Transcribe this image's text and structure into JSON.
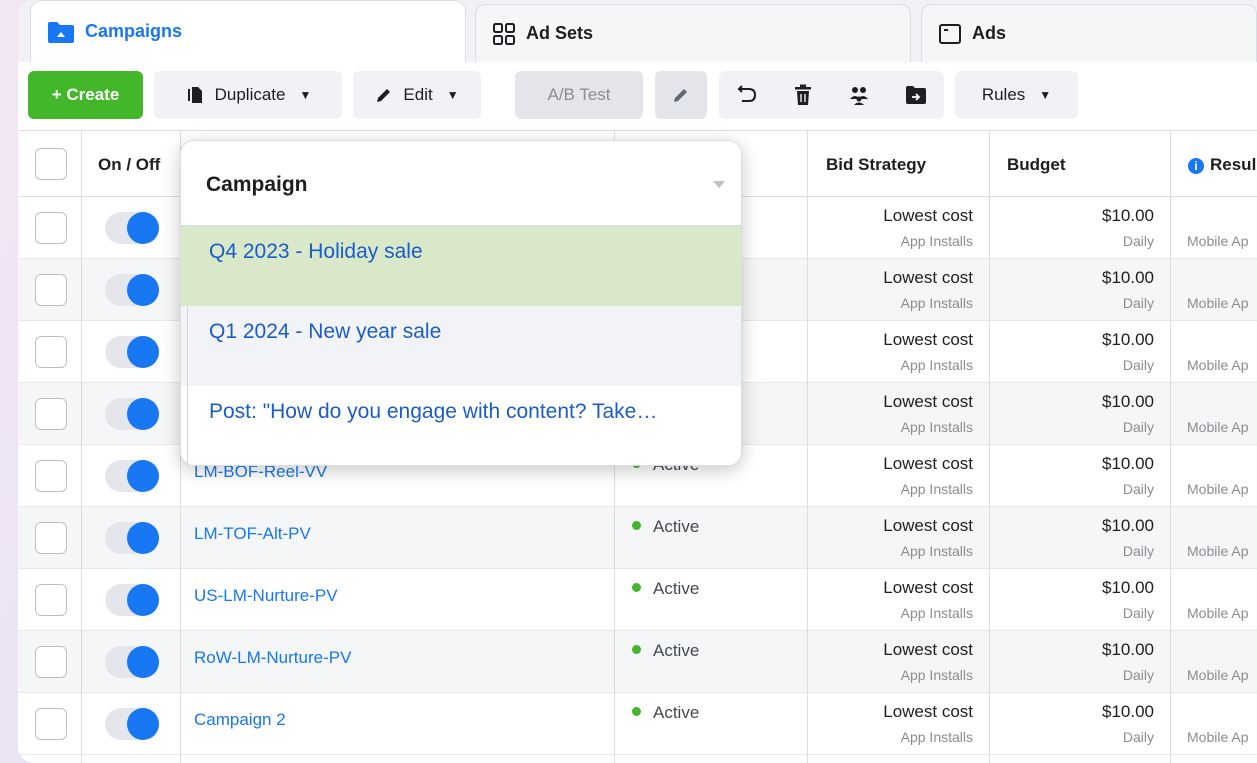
{
  "tabs": [
    {
      "label": "Campaigns",
      "icon": "folder-icon",
      "active": true
    },
    {
      "label": "Ad Sets",
      "icon": "grid-icon",
      "active": false
    },
    {
      "label": "Ads",
      "icon": "ad-frame-icon",
      "active": false
    }
  ],
  "toolbar": {
    "create_label": "+ Create",
    "duplicate_label": "Duplicate",
    "edit_label": "Edit",
    "ab_test_label": "A/B Test",
    "rules_label": "Rules"
  },
  "table": {
    "headers": {
      "on_off": "On / Off",
      "bid_strategy": "Bid Strategy",
      "budget": "Budget",
      "results": "Resul"
    },
    "rows": [
      {
        "name": "",
        "status": "",
        "bid": "Lowest cost",
        "bid_sub": "App Installs",
        "budget": "$10.00",
        "budget_sub": "Daily",
        "result_sub": "Mobile Ap"
      },
      {
        "name": "",
        "status": "",
        "bid": "Lowest cost",
        "bid_sub": "App Installs",
        "budget": "$10.00",
        "budget_sub": "Daily",
        "result_sub": "Mobile Ap"
      },
      {
        "name": "",
        "status": "",
        "bid": "Lowest cost",
        "bid_sub": "App Installs",
        "budget": "$10.00",
        "budget_sub": "Daily",
        "result_sub": "Mobile Ap"
      },
      {
        "name": "",
        "status": "",
        "bid": "Lowest cost",
        "bid_sub": "App Installs",
        "budget": "$10.00",
        "budget_sub": "Daily",
        "result_sub": "Mobile Ap"
      },
      {
        "name": "LM-BOF-Reel-VV",
        "status": "Active",
        "bid": "Lowest cost",
        "bid_sub": "App Installs",
        "budget": "$10.00",
        "budget_sub": "Daily",
        "result_sub": "Mobile Ap"
      },
      {
        "name": "LM-TOF-Alt-PV",
        "status": "Active",
        "bid": "Lowest cost",
        "bid_sub": "App Installs",
        "budget": "$10.00",
        "budget_sub": "Daily",
        "result_sub": "Mobile Ap"
      },
      {
        "name": "US-LM-Nurture-PV",
        "status": "Active",
        "bid": "Lowest cost",
        "bid_sub": "App Installs",
        "budget": "$10.00",
        "budget_sub": "Daily",
        "result_sub": "Mobile Ap"
      },
      {
        "name": "RoW-LM-Nurture-PV",
        "status": "Active",
        "bid": "Lowest cost",
        "bid_sub": "App Installs",
        "budget": "$10.00",
        "budget_sub": "Daily",
        "result_sub": "Mobile Ap"
      },
      {
        "name": "Campaign 2",
        "status": "Active",
        "bid": "Lowest cost",
        "bid_sub": "App Installs",
        "budget": "$10.00",
        "budget_sub": "Daily",
        "result_sub": "Mobile Ap"
      }
    ]
  },
  "dropdown": {
    "title": "Campaign",
    "items": [
      "Q4 2023 - Holiday sale",
      "Q1 2024 - New year sale",
      "Post: \"How do you engage with content? Take…"
    ]
  },
  "colors": {
    "accent": "#1877f2",
    "create_green": "#42b72a",
    "highlight": "#d8e8c8",
    "active_dot": "#42b72a"
  }
}
